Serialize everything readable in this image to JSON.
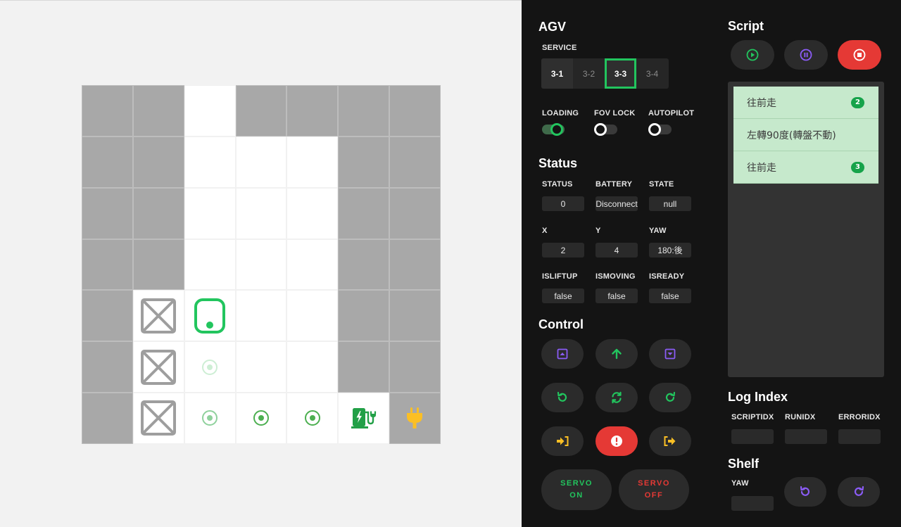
{
  "map": {
    "rows": [
      [
        "wall",
        "wall",
        "floor",
        "wall",
        "wall",
        "wall",
        "wall"
      ],
      [
        "wall",
        "wall",
        "floor",
        "floor",
        "floor",
        "wall",
        "wall"
      ],
      [
        "wall",
        "wall",
        "floor",
        "floor",
        "floor",
        "wall",
        "wall"
      ],
      [
        "wall",
        "wall",
        "floor",
        "floor",
        "floor",
        "wall",
        "wall"
      ],
      [
        "wall",
        "shelf",
        "agv",
        "floor",
        "floor",
        "wall",
        "wall"
      ],
      [
        "wall",
        "shelf",
        "waypoint-faded",
        "floor",
        "floor",
        "wall",
        "wall"
      ],
      [
        "wall",
        "shelf",
        "waypoint-light",
        "waypoint",
        "waypoint",
        "charger",
        "plug"
      ]
    ]
  },
  "agv": {
    "title": "AGV",
    "service_label": "SERVICE",
    "services": [
      "3-1",
      "3-2",
      "3-3",
      "3-4"
    ],
    "active_service": "3-3",
    "toggles": [
      {
        "label": "LOADING",
        "on": true
      },
      {
        "label": "FOV LOCK",
        "on": false
      },
      {
        "label": "AUTOPILOT",
        "on": false
      }
    ]
  },
  "status": {
    "title": "Status",
    "fields": [
      {
        "label": "STATUS",
        "value": "0"
      },
      {
        "label": "BATTERY",
        "value": "Disconnect"
      },
      {
        "label": "STATE",
        "value": "null"
      },
      {
        "label": "X",
        "value": "2"
      },
      {
        "label": "Y",
        "value": "4"
      },
      {
        "label": "YAW",
        "value": "180:後"
      },
      {
        "label": "ISLIFTUP",
        "value": "false"
      },
      {
        "label": "ISMOVING",
        "value": "false"
      },
      {
        "label": "ISREADY",
        "value": "false"
      }
    ]
  },
  "control": {
    "title": "Control",
    "buttons": [
      "lift-up-icon",
      "arrow-up-icon",
      "lift-down-icon",
      "rotate-left-icon",
      "rotate-180-icon",
      "rotate-right-icon",
      "enter-icon",
      "emergency-icon",
      "exit-icon"
    ],
    "servo_on": [
      "SERVO",
      "ON"
    ],
    "servo_off": [
      "SERVO",
      "OFF"
    ]
  },
  "script": {
    "title": "Script",
    "steps": [
      {
        "text": "往前走",
        "badge": "2"
      },
      {
        "text": "左轉90度(轉盤不動)",
        "badge": ""
      },
      {
        "text": "往前走",
        "badge": "3"
      }
    ]
  },
  "log_index": {
    "title": "Log Index",
    "fields": [
      {
        "label": "SCRIPTIDX",
        "value": ""
      },
      {
        "label": "RUNIDX",
        "value": ""
      },
      {
        "label": "ERRORIDX",
        "value": ""
      }
    ]
  },
  "shelf": {
    "title": "Shelf",
    "yaw_label": "YAW",
    "yaw_value": ""
  },
  "colors": {
    "accent_green": "#22c55e",
    "accent_purple": "#8b5cf6",
    "danger_red": "#e53935",
    "warning_yellow": "#fbbf24",
    "wall_gray": "#a8a8a8"
  }
}
